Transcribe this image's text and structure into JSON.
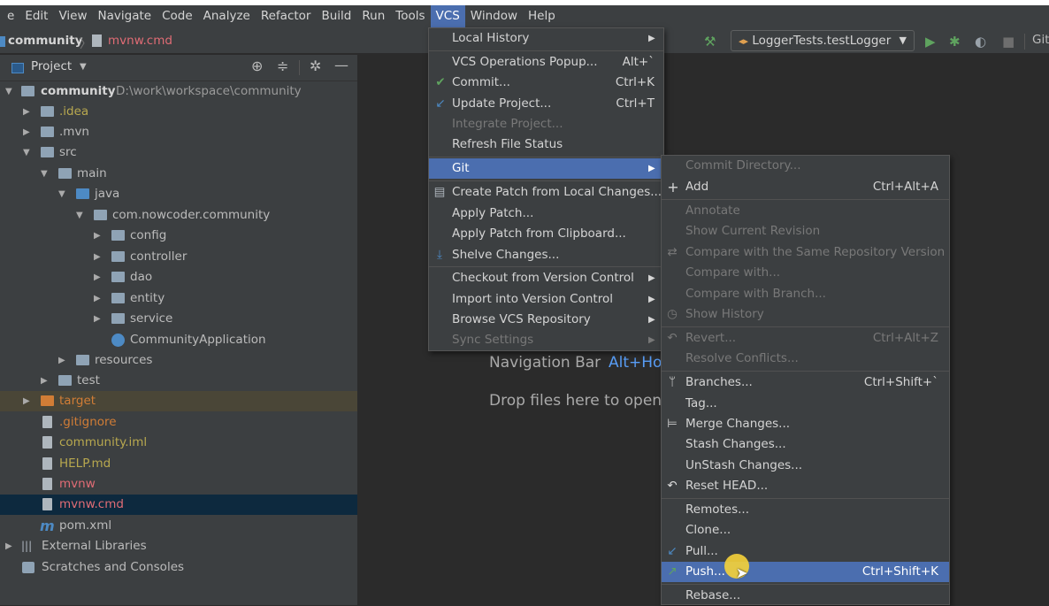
{
  "menubar": {
    "items": [
      "e",
      "Edit",
      "View",
      "Navigate",
      "Code",
      "Analyze",
      "Refactor",
      "Build",
      "Run",
      "Tools",
      "VCS",
      "Window",
      "Help"
    ]
  },
  "breadcrumb": {
    "project": "community",
    "file": "mvnw.cmd"
  },
  "run_config": {
    "label": "LoggerTests.testLogger",
    "git_label": "Git"
  },
  "project_panel": {
    "title": "Project",
    "tree": [
      {
        "label": "community",
        "extra": "D:\\work\\workspace\\community"
      },
      {
        "label": ".idea"
      },
      {
        "label": ".mvn"
      },
      {
        "label": "src"
      },
      {
        "label": "main"
      },
      {
        "label": "java"
      },
      {
        "label": "com.nowcoder.community"
      },
      {
        "label": "config"
      },
      {
        "label": "controller"
      },
      {
        "label": "dao"
      },
      {
        "label": "entity"
      },
      {
        "label": "service"
      },
      {
        "label": "CommunityApplication"
      },
      {
        "label": "resources"
      },
      {
        "label": "test"
      },
      {
        "label": "target"
      },
      {
        "label": ".gitignore"
      },
      {
        "label": "community.iml"
      },
      {
        "label": "HELP.md"
      },
      {
        "label": "mvnw"
      },
      {
        "label": "mvnw.cmd"
      },
      {
        "label": "pom.xml"
      },
      {
        "label": "External Libraries"
      },
      {
        "label": "Scratches and Consoles"
      }
    ]
  },
  "editor": {
    "nav_bar_label": "Navigation Bar",
    "nav_bar_shortcut": "Alt+Ho",
    "drop_files": "Drop files here to open"
  },
  "vcs_menu": {
    "items": [
      {
        "label": "Local History",
        "shortcut": ""
      },
      {
        "label": "VCS Operations Popup...",
        "shortcut": "Alt+`"
      },
      {
        "label": "Commit...",
        "shortcut": "Ctrl+K"
      },
      {
        "label": "Update Project...",
        "shortcut": "Ctrl+T"
      },
      {
        "label": "Integrate Project...",
        "shortcut": ""
      },
      {
        "label": "Refresh File Status",
        "shortcut": ""
      },
      {
        "label": "Git",
        "shortcut": ""
      },
      {
        "label": "Create Patch from Local Changes...",
        "shortcut": ""
      },
      {
        "label": "Apply Patch...",
        "shortcut": ""
      },
      {
        "label": "Apply Patch from Clipboard...",
        "shortcut": ""
      },
      {
        "label": "Shelve Changes...",
        "shortcut": ""
      },
      {
        "label": "Checkout from Version Control",
        "shortcut": ""
      },
      {
        "label": "Import into Version Control",
        "shortcut": ""
      },
      {
        "label": "Browse VCS Repository",
        "shortcut": ""
      },
      {
        "label": "Sync Settings",
        "shortcut": ""
      }
    ]
  },
  "git_menu": {
    "items": [
      {
        "label": "Commit Directory...",
        "shortcut": ""
      },
      {
        "label": "Add",
        "shortcut": "Ctrl+Alt+A"
      },
      {
        "label": "Annotate",
        "shortcut": ""
      },
      {
        "label": "Show Current Revision",
        "shortcut": ""
      },
      {
        "label": "Compare with the Same Repository Version",
        "shortcut": ""
      },
      {
        "label": "Compare with...",
        "shortcut": ""
      },
      {
        "label": "Compare with Branch...",
        "shortcut": ""
      },
      {
        "label": "Show History",
        "shortcut": ""
      },
      {
        "label": "Revert...",
        "shortcut": "Ctrl+Alt+Z"
      },
      {
        "label": "Resolve Conflicts...",
        "shortcut": ""
      },
      {
        "label": "Branches...",
        "shortcut": "Ctrl+Shift+`"
      },
      {
        "label": "Tag...",
        "shortcut": ""
      },
      {
        "label": "Merge Changes...",
        "shortcut": ""
      },
      {
        "label": "Stash Changes...",
        "shortcut": ""
      },
      {
        "label": "UnStash Changes...",
        "shortcut": ""
      },
      {
        "label": "Reset HEAD...",
        "shortcut": ""
      },
      {
        "label": "Remotes...",
        "shortcut": ""
      },
      {
        "label": "Clone...",
        "shortcut": ""
      },
      {
        "label": "Pull...",
        "shortcut": ""
      },
      {
        "label": "Push...",
        "shortcut": "Ctrl+Shift+K"
      },
      {
        "label": "Rebase...",
        "shortcut": ""
      }
    ]
  },
  "colors": {
    "menu_bg": "#3c3f41",
    "highlight": "#4b6eaf",
    "editor_bg": "#2b2b2b",
    "selected_row": "#0d293e",
    "orange_text": "#d17d36",
    "olive_text": "#b8a84f",
    "disabled_text": "#787878"
  }
}
